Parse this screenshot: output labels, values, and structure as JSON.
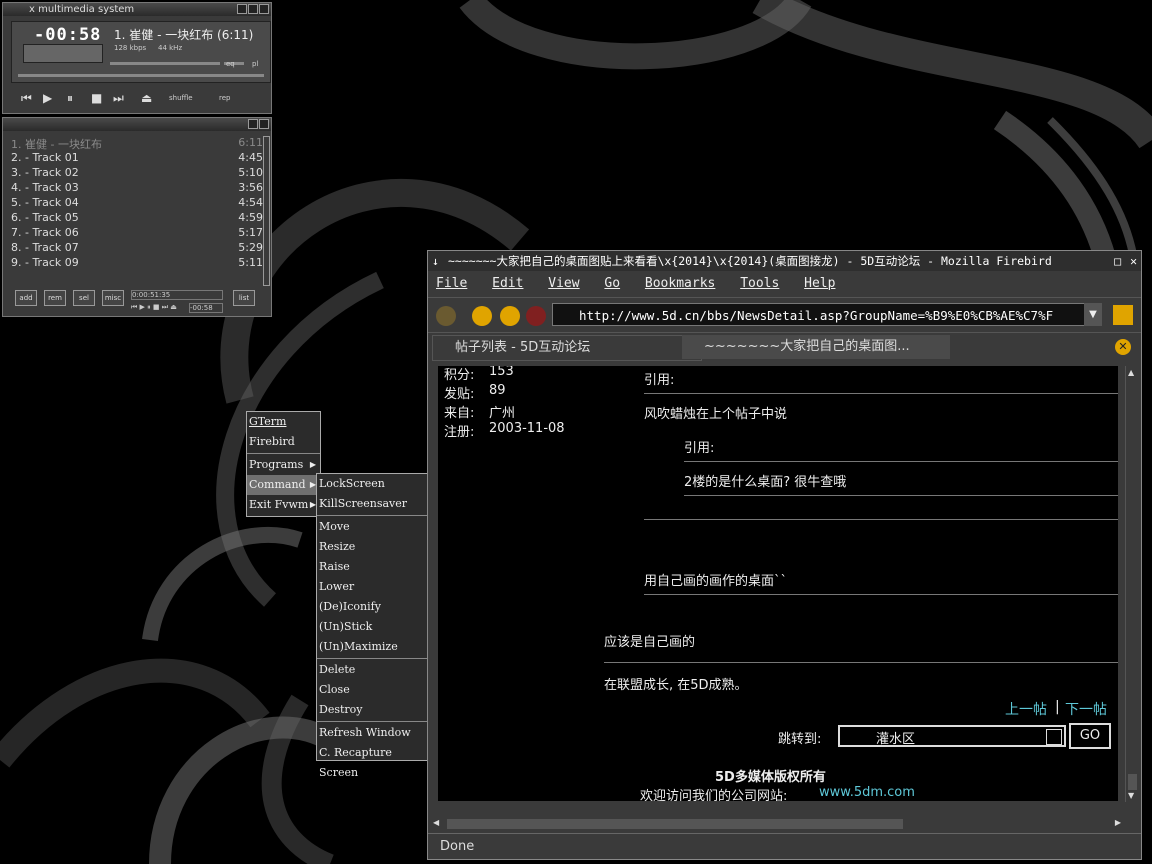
{
  "xmms": {
    "title": "x multimedia system",
    "time": "-00:58",
    "song": "1. 崔健 - 一块红布 (6:11)",
    "kbps": "128 kbps",
    "khz": "44 kHz",
    "eq": "eq",
    "pl": "pl",
    "shuffle": "shuffle",
    "repeat": "rep",
    "icons": {
      "prev": "prev-icon",
      "play": "play-icon",
      "pause": "pause-icon",
      "stop": "stop-icon",
      "next": "next-icon",
      "eject": "eject-icon"
    }
  },
  "playlist": {
    "rows": [
      {
        "title": "1. 崔健 - 一块红布",
        "dur": "6:11"
      },
      {
        "title": "2. - Track 01",
        "dur": "4:45"
      },
      {
        "title": "3. - Track 02",
        "dur": "5:10"
      },
      {
        "title": "4. - Track 03",
        "dur": "3:56"
      },
      {
        "title": "5. - Track 04",
        "dur": "4:54"
      },
      {
        "title": "6. - Track 05",
        "dur": "4:59"
      },
      {
        "title": "7. - Track 06",
        "dur": "5:17"
      },
      {
        "title": "8. - Track 07",
        "dur": "5:29"
      },
      {
        "title": "9. - Track 09",
        "dur": "5:11"
      }
    ],
    "buttons": {
      "add": "add",
      "rem": "rem",
      "sel": "sel",
      "misc": "misc",
      "list": "list"
    },
    "total": "0:00:51:35",
    "remaining": "-00:58"
  },
  "menu": {
    "root": [
      "GTerm",
      "Firebird",
      "Programs",
      "Command",
      "Exit Fvwm"
    ],
    "command_items": [
      "LockScreen",
      "KillScreensaver"
    ],
    "window_ops_1": [
      "Move",
      "Resize",
      "Raise",
      "Lower",
      "(De)Iconify",
      "(Un)Stick",
      "(Un)Maximize"
    ],
    "window_ops_2": [
      "Delete",
      "Close",
      "Destroy"
    ],
    "window_ops_3": [
      "Refresh Window",
      "C. Recapture Screen"
    ]
  },
  "firebird": {
    "title": "~~~~~~~大家把自己的桌面图贴上来看看\\x{2014}\\x{2014}(桌面图接龙) - 5D互动论坛 - Mozilla Firebird",
    "menubar": [
      "File",
      "Edit",
      "View",
      "Go",
      "Bookmarks",
      "Tools",
      "Help"
    ],
    "url": "http://www.5d.cn/bbs/NewsDetail.asp?GroupName=%B9%E0%CB%AE%C7%F",
    "tabs": [
      "帖子列表 - 5D互动论坛",
      "~~~~~~~大家把自己的桌面图..."
    ],
    "status": "Done",
    "post": {
      "score_label": "积分:",
      "score": "153",
      "posts_label": "发贴:",
      "posts": "89",
      "from_label": "来自:",
      "from": "广州",
      "reg_label": "注册:",
      "reg": "2003-11-08",
      "quote1": "引用:",
      "quote1_text": "风吹蜡烛在上个帖子中说",
      "quote2": "引用:",
      "quote2_text": "2楼的是什么桌面? 很牛查哦",
      "body1": "用自己画的画作的桌面``",
      "body2": "应该是自己画的",
      "signature": "在联盟成长, 在5D成熟。",
      "prev": "上一帖",
      "sep": "|",
      "next": "下一帖",
      "jump_label": "跳转到:",
      "jump_value": "灌水区",
      "go": "GO",
      "footer1": "5D多媒体版权所有",
      "footer2": "欢迎访问我们的公司网站:",
      "footer_link": "www.5dm.com"
    },
    "colors": {
      "link": "#5ec8d8"
    }
  }
}
